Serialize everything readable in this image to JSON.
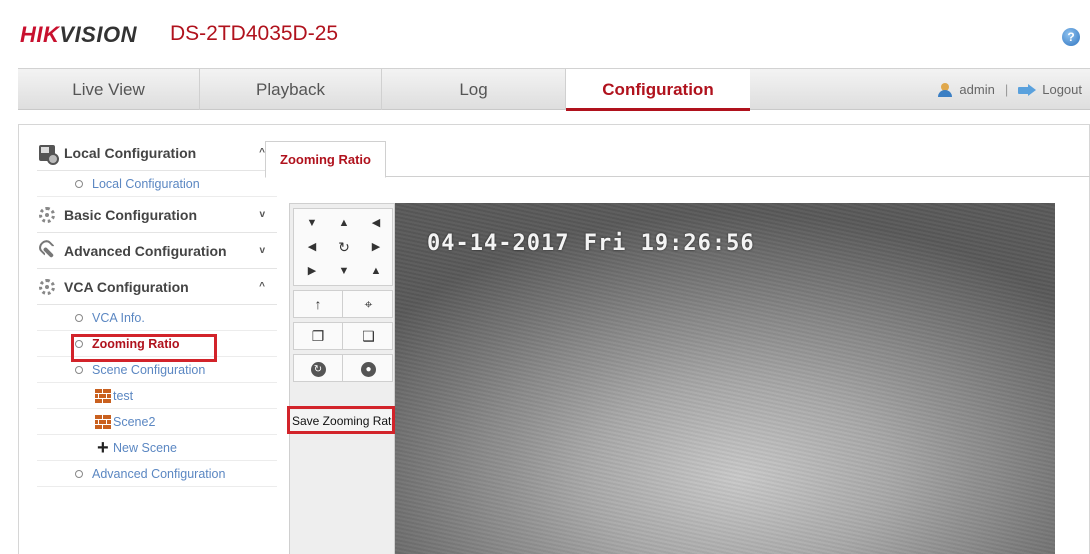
{
  "header": {
    "logo_hik": "HIK",
    "logo_vision": "VISION",
    "model": "DS-2TD4035D-25",
    "help_label": "?"
  },
  "nav": {
    "tabs": [
      {
        "label": "Live View"
      },
      {
        "label": "Playback"
      },
      {
        "label": "Log"
      },
      {
        "label": "Configuration"
      }
    ],
    "active_tab": "Configuration",
    "user": "admin",
    "separator": "|",
    "logout": "Logout"
  },
  "sidebar": {
    "local": {
      "label": "Local Configuration",
      "caret": "^",
      "items": [
        "Local Configuration"
      ]
    },
    "basic": {
      "label": "Basic Configuration",
      "caret": "v"
    },
    "advanced": {
      "label": "Advanced Configuration",
      "caret": "v"
    },
    "vca": {
      "label": "VCA Configuration",
      "caret": "^",
      "items": {
        "vca_info": "VCA Info.",
        "zooming_ratio": "Zooming Ratio",
        "scene_configuration": "Scene Configuration",
        "scene_test": "test",
        "scene_2": "Scene2",
        "new_scene": "New Scene",
        "advanced_configuration": "Advanced Configuration"
      }
    },
    "active_item": "Zooming Ratio"
  },
  "tab_panel": {
    "tab_label": "Zooming Ratio"
  },
  "ptz": {
    "save_label": "Save Zooming Ratio"
  },
  "video": {
    "osd_timestamp": "04-14-2017 Fri 19:26:56"
  },
  "colors": {
    "brand_red": "#b0121d",
    "highlight_red": "#d2232a",
    "link_blue": "#5b87c2"
  }
}
